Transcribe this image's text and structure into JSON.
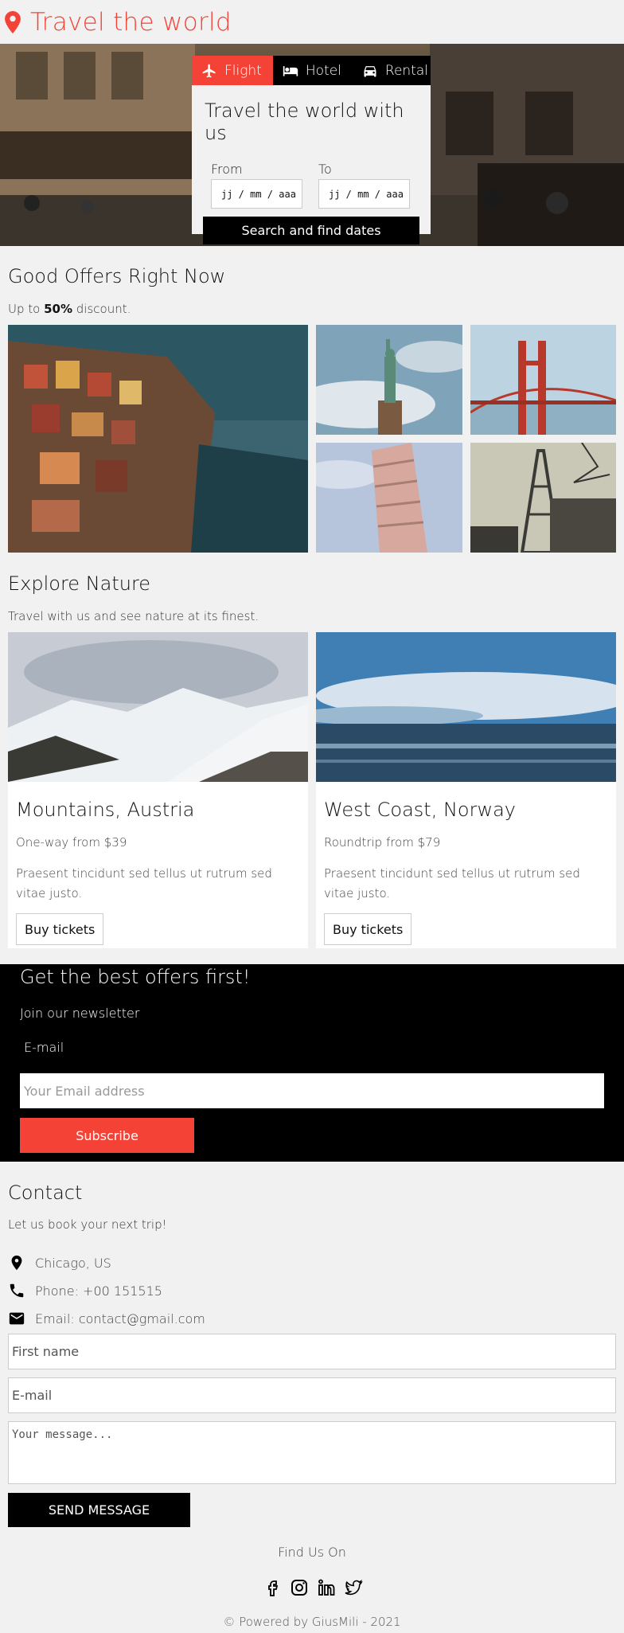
{
  "header": {
    "title": "Travel the world",
    "icon": "map-pin-icon",
    "accent": "#f44336"
  },
  "booking": {
    "tabs": [
      {
        "label": "Flight",
        "icon": "airplane-icon",
        "active": true
      },
      {
        "label": "Hotel",
        "icon": "bed-icon",
        "active": false
      },
      {
        "label": "Rental",
        "icon": "car-icon",
        "active": false
      }
    ],
    "heading": "Travel the world with us",
    "from_label": "From",
    "to_label": "To",
    "from_value": "jj / mm / aaa",
    "to_value": "jj / mm / aaa",
    "search_label": "Search and find dates"
  },
  "offers": {
    "title": "Good Offers Right Now",
    "sub_prefix": "Up to ",
    "sub_bold": "50%",
    "sub_suffix": " discount."
  },
  "nature": {
    "title": "Explore Nature",
    "subtitle": "Travel with us and see nature at its finest.",
    "cards": [
      {
        "title": "Mountains, Austria",
        "price": "One-way from $39",
        "desc": "Praesent tincidunt sed tellus ut rutrum sed vitae justo.",
        "button": "Buy tickets"
      },
      {
        "title": "West Coast, Norway",
        "price": "Roundtrip from $79",
        "desc": "Praesent tincidunt sed tellus ut rutrum sed vitae justo.",
        "button": "Buy tickets"
      }
    ]
  },
  "newsletter": {
    "title": "Get the best offers first!",
    "join": "Join our newsletter",
    "email_label": "E-mail",
    "email_placeholder": "Your Email address",
    "subscribe": "Subscribe"
  },
  "contact": {
    "title": "Contact",
    "subtitle": "Let us book your next trip!",
    "location": "Chicago, US",
    "phone": "Phone: +00 151515",
    "email": "Email: contact@gmail.com",
    "first_name_placeholder": "First name",
    "email_placeholder": "E-mail",
    "message_placeholder": "Your message...",
    "send": "SEND MESSAGE"
  },
  "footer": {
    "find_us": "Find Us On",
    "socials": [
      "facebook-icon",
      "instagram-icon",
      "linkedin-icon",
      "twitter-icon"
    ],
    "powered": "© Powered by GiusMili - 2021"
  }
}
